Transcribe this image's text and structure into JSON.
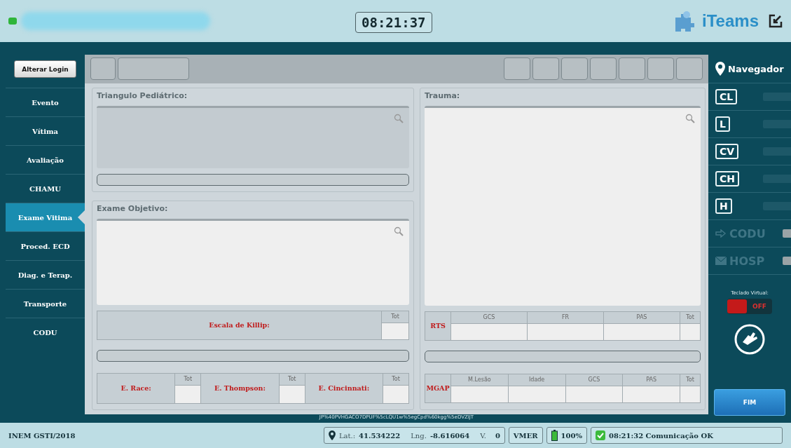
{
  "header": {
    "clock": "08:21:37",
    "app_name": "iTeams"
  },
  "sidebar": {
    "login_button": "Alterar Login",
    "items": [
      {
        "label": "Evento",
        "selected": false
      },
      {
        "label": "Vítima",
        "selected": false
      },
      {
        "label": "Avaliação",
        "selected": false
      },
      {
        "label": "CHAMU",
        "selected": false
      },
      {
        "label": "Exame Vitima",
        "selected": true
      },
      {
        "label": "Proced.  ECD",
        "selected": false
      },
      {
        "label": "Diag. e Terap.",
        "selected": false
      },
      {
        "label": "Transporte",
        "selected": false
      },
      {
        "label": "CODU",
        "selected": false
      }
    ]
  },
  "left_column": {
    "pediatric": {
      "title": "Triangulo Pediátrico:"
    },
    "exam": {
      "title": "Exame Objetivo:",
      "killip": {
        "label": "Escala de Killip:",
        "column": "Tot"
      },
      "scores": [
        {
          "label": "E. Race:",
          "column": "Tot"
        },
        {
          "label": "E. Thompson:",
          "column": "Tot"
        },
        {
          "label": "E. Cincinnati:",
          "column": "Tot"
        }
      ]
    }
  },
  "trauma": {
    "title": "Trauma:",
    "tables": [
      {
        "label": "RTS",
        "columns": [
          "GCS",
          "FR",
          "PAS",
          "Tot"
        ]
      },
      {
        "label": "MGAP",
        "columns": [
          "M.Lesão",
          "Idade",
          "GCS",
          "PAS",
          "Tot"
        ]
      }
    ]
  },
  "code_text": "JP%40PVHGACO7DPUF%5cLQU1w%5egCpd%60kgg%5eDVZIJT",
  "right_panel": {
    "navigator": "Navegador",
    "shortcuts": [
      {
        "label": "CL",
        "kind": "box",
        "disabled": false
      },
      {
        "label": "L",
        "kind": "box",
        "disabled": false
      },
      {
        "label": "CV",
        "kind": "box",
        "disabled": false
      },
      {
        "label": "CH",
        "kind": "box",
        "disabled": false
      },
      {
        "label": "H",
        "kind": "box",
        "disabled": false
      },
      {
        "label": "CODU",
        "kind": "arrow",
        "disabled": true
      },
      {
        "label": "HOSP",
        "kind": "mail",
        "disabled": true
      }
    ],
    "keyboard": {
      "label": "Teclado Virtual:",
      "on": false,
      "state_text": "OFF"
    },
    "finish_button": "FIM"
  },
  "status_bar": {
    "copyright": "INEM GSTI/2018",
    "lat_label": "Lat.:",
    "lat": "41.534222",
    "lng_label": "Lng.",
    "lng": "-8.616064",
    "v_label": "V.",
    "v": "0",
    "unit": "VMER",
    "battery": "100%",
    "comm": "08:21:32 Comunicação OK"
  }
}
